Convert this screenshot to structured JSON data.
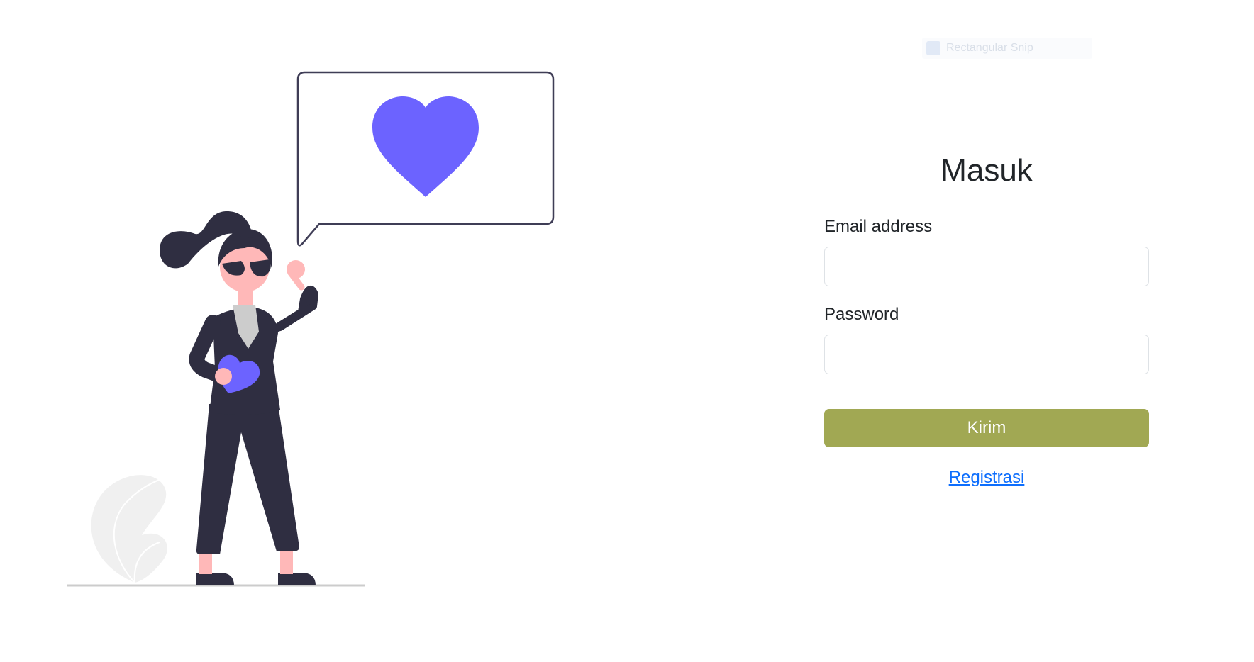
{
  "overlay": {
    "label": "Rectangular Snip"
  },
  "login": {
    "title": "Masuk",
    "email_label": "Email address",
    "email_value": "",
    "password_label": "Password",
    "password_value": "",
    "submit_label": "Kirim",
    "register_label": "Registrasi"
  },
  "colors": {
    "submit_bg": "#a1a853",
    "accent_purple": "#6c63ff",
    "figure_dark": "#2f2e41",
    "skin": "#ffb8b8",
    "link": "#0d6efd"
  }
}
